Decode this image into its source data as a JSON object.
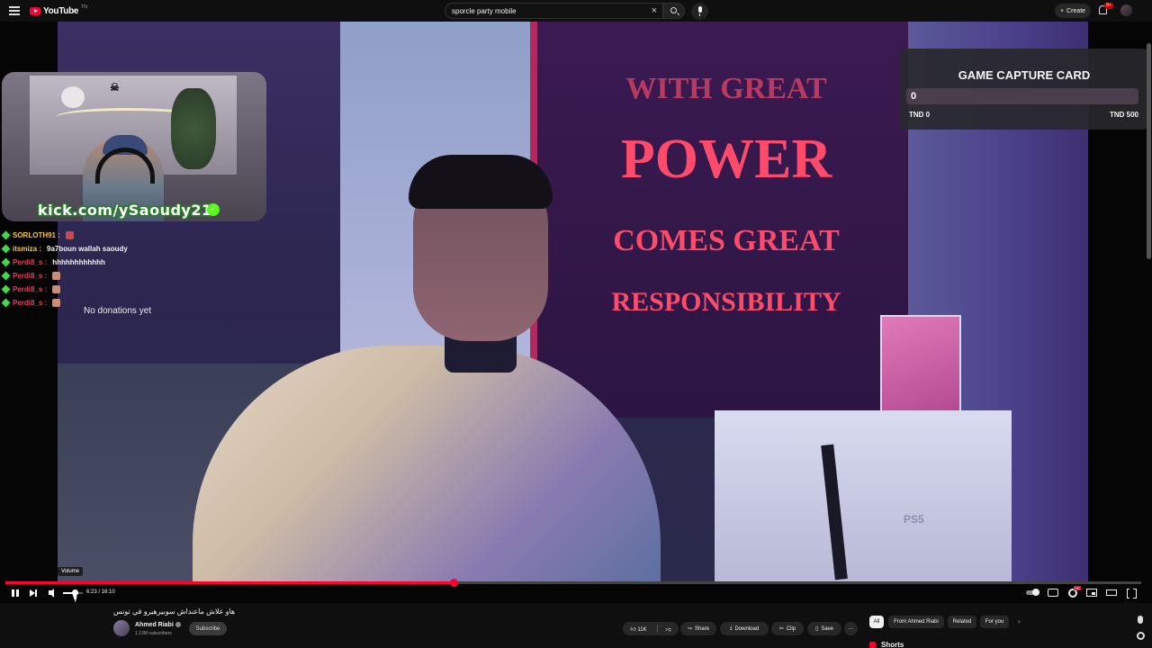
{
  "header": {
    "logo_text": "YouTube",
    "logo_region": "TN",
    "search_value": "sporcle party mobile",
    "create_label": "Create",
    "notification_count": "9+"
  },
  "webcam": {
    "url_text": "kick.com/ySaoudy21"
  },
  "chat": {
    "messages": [
      {
        "user": "SORLOTH91",
        "user_color": "#f5c542",
        "text": "",
        "emote": true
      },
      {
        "user": "itsmiza",
        "user_color": "#f5c542",
        "text": "9a7boun wallah saoudy",
        "emote": false
      },
      {
        "user": "Perdi8_s",
        "user_color": "#e0415a",
        "text": "hhhhhhhhhhhh",
        "emote": false
      },
      {
        "user": "Perdi8_s",
        "user_color": "#e0415a",
        "text": "",
        "emote": true
      },
      {
        "user": "Perdi8_s",
        "user_color": "#e0415a",
        "text": "",
        "emote": true
      },
      {
        "user": "Perdi8_s",
        "user_color": "#e0415a",
        "text": "",
        "emote": true
      }
    ],
    "no_donations": "No donations yet"
  },
  "video_scene": {
    "banner_line1": "WITH GREAT",
    "banner_line2": "POWER",
    "banner_line3": "COMES GREAT",
    "banner_line4": "RESPONSIBILITY",
    "console_logo": "PS5"
  },
  "goal_widget": {
    "title": "GAME CAPTURE CARD",
    "current": "0",
    "min_label": "TND 0",
    "max_label": "TND 500",
    "progress_fraction": 0.0
  },
  "player": {
    "tooltip": "Volume",
    "current_time": "6:23",
    "duration": "16:10",
    "time_display": "6:23 / 16:10",
    "played_fraction": 0.395,
    "loaded_fraction": 0.395,
    "volume_fraction": 0.6,
    "hd_badge": "HD"
  },
  "video_info": {
    "title": "هاو علاش ماعنداش سوبيرهيرو في تونس",
    "channel_name": "Ahmed Riabi",
    "subscribers": "1.13M subscribers",
    "subscribe_label": "Subscribe",
    "likes": "11K",
    "share_label": "Share",
    "download_label": "Download",
    "clip_label": "Clip",
    "save_label": "Save",
    "more_label": "···"
  },
  "sidebar": {
    "chips": [
      "All",
      "From Ahmed Riabi",
      "Related",
      "For you"
    ],
    "shorts_label": "Shorts"
  },
  "colors": {
    "accent_red": "#ff0033",
    "kick_green": "#53fc18"
  }
}
